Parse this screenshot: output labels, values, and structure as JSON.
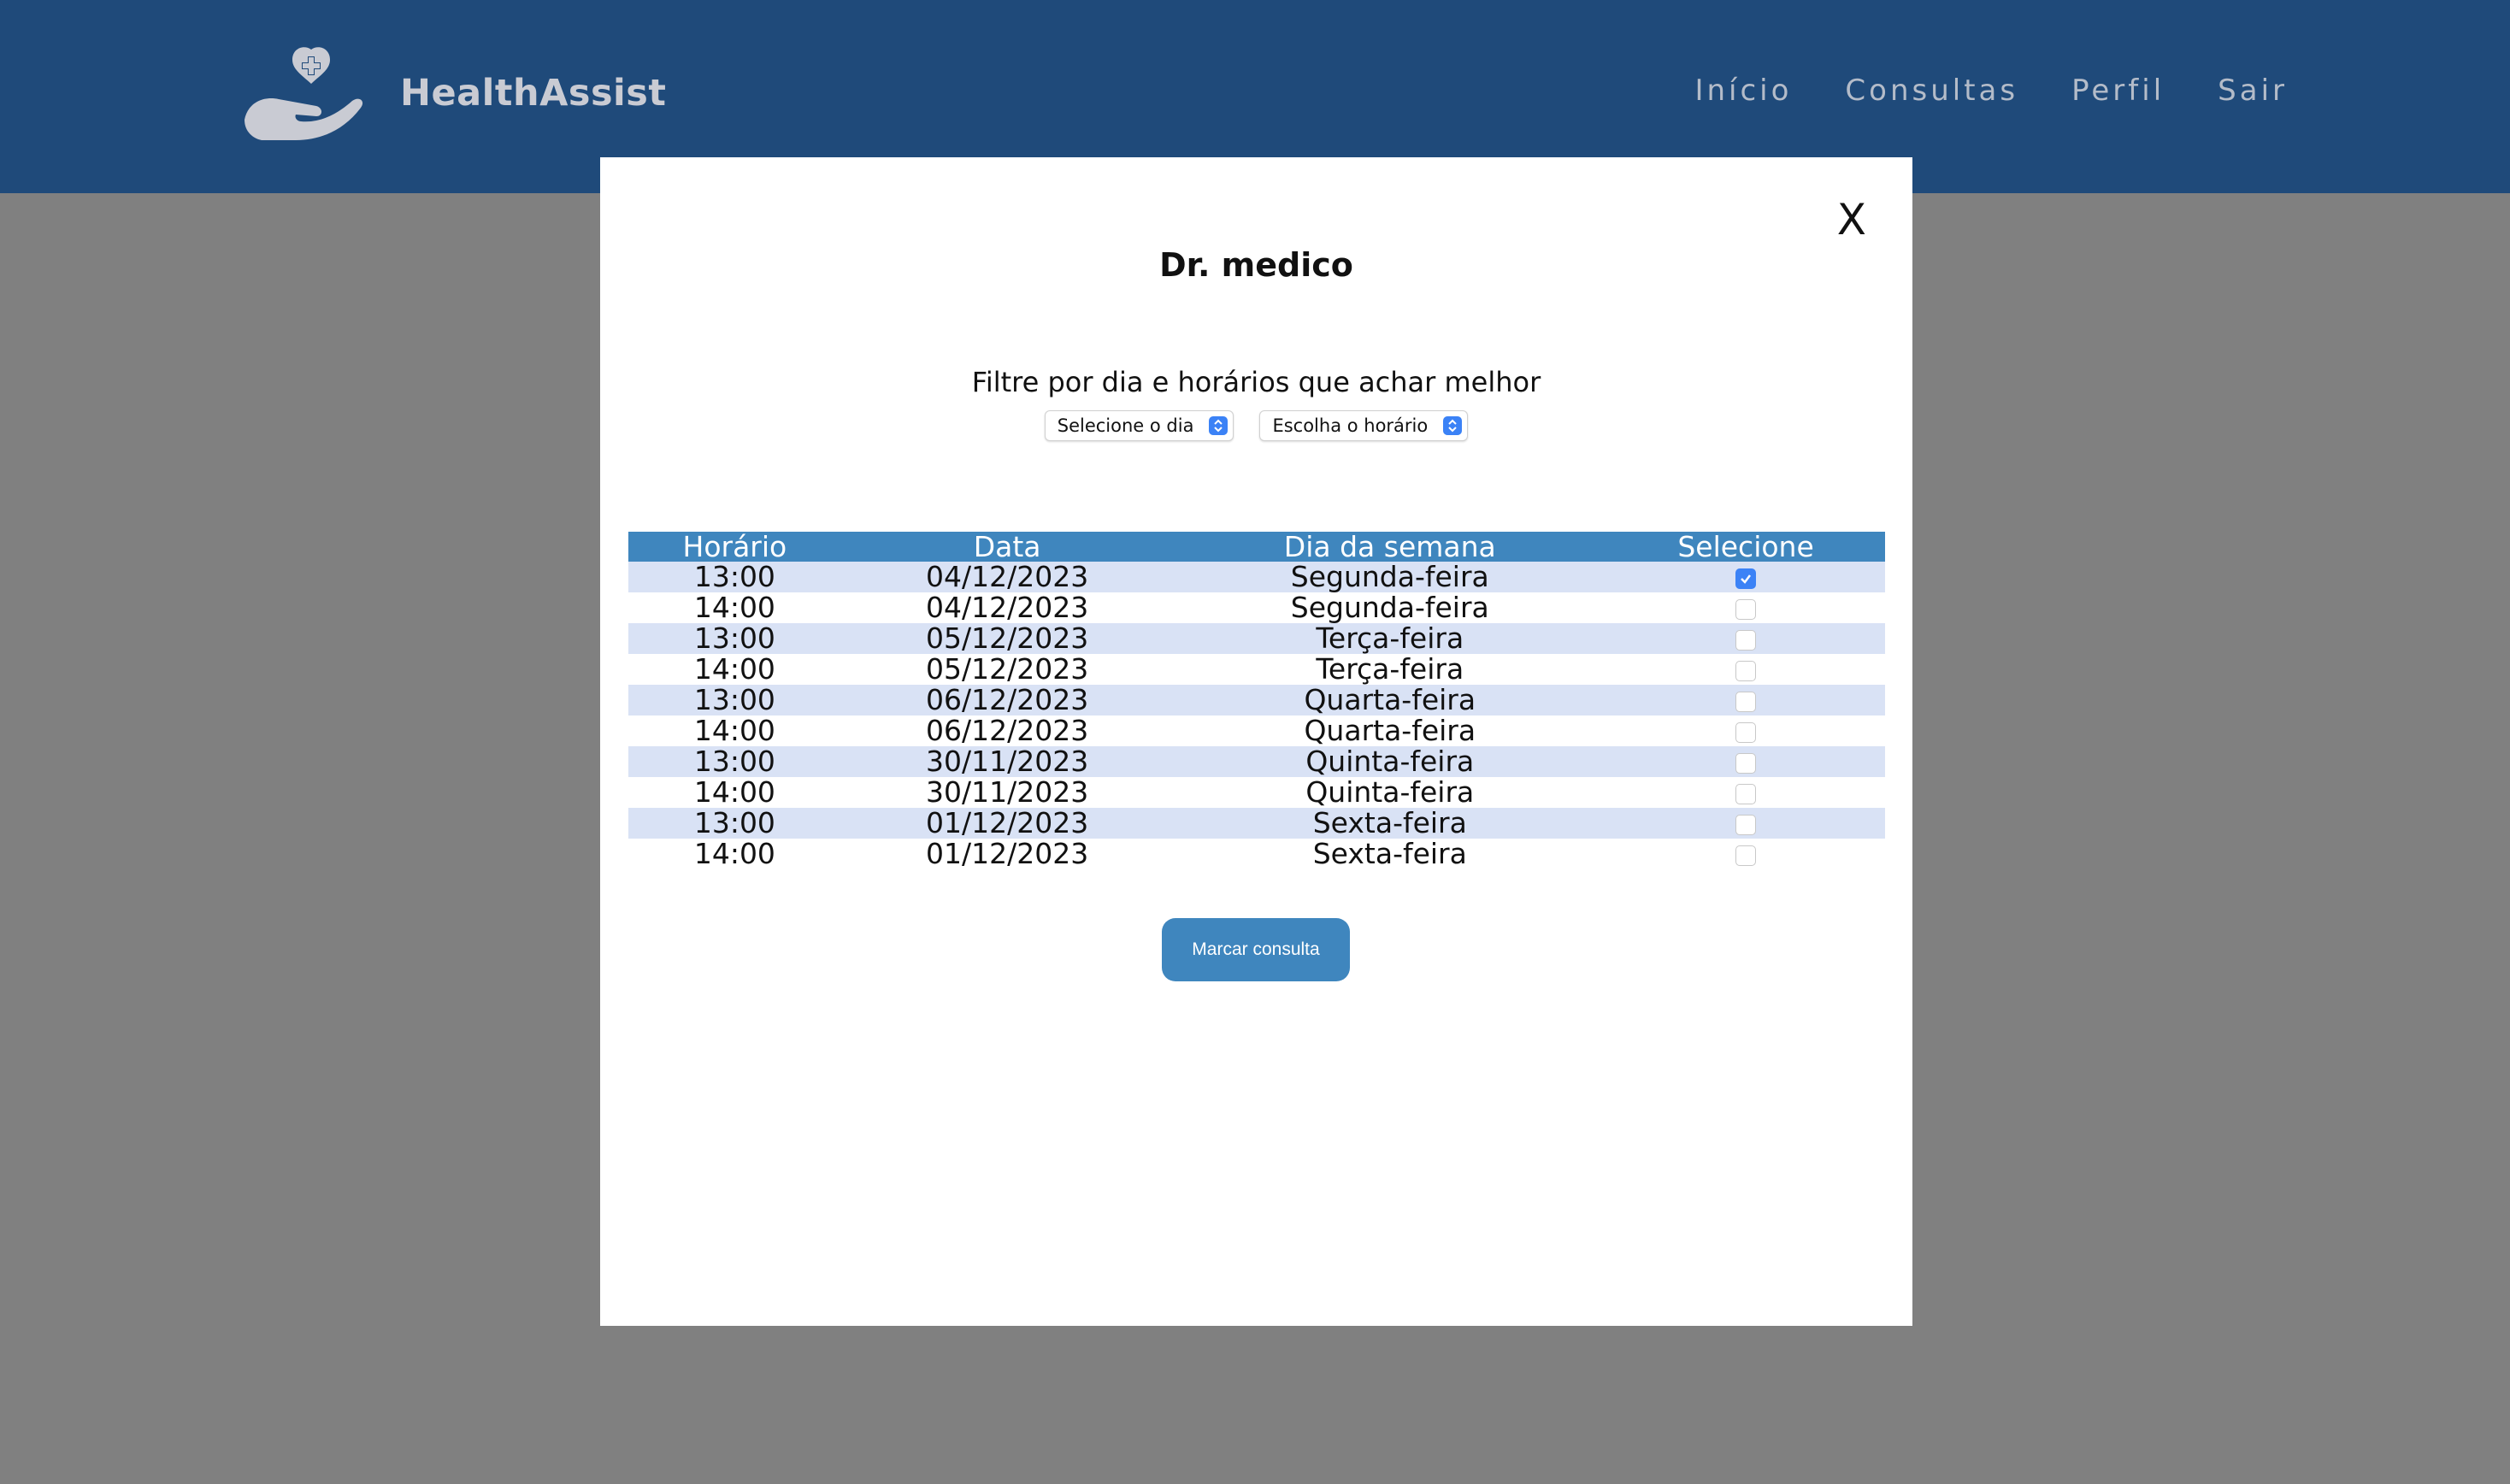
{
  "header": {
    "brand_name": "HealthAssist",
    "nav": [
      "Início",
      "Consultas",
      "Perfil",
      "Sair"
    ],
    "background_color": "#1f4a7a"
  },
  "modal": {
    "close_label": "X",
    "doctor_name": "Dr. medico",
    "filter_text": "Filtre por dia e horários que achar melhor",
    "day_select": "Selecione o dia",
    "time_select": "Escolha o horário",
    "table": {
      "headers": [
        "Horário",
        "Data",
        "Dia da semana",
        "Selecione"
      ],
      "rows": [
        {
          "time": "13:00",
          "date": "04/12/2023",
          "weekday": "Segunda-feira",
          "selected": true
        },
        {
          "time": "14:00",
          "date": "04/12/2023",
          "weekday": "Segunda-feira",
          "selected": false
        },
        {
          "time": "13:00",
          "date": "05/12/2023",
          "weekday": "Terça-feira",
          "selected": false
        },
        {
          "time": "14:00",
          "date": "05/12/2023",
          "weekday": "Terça-feira",
          "selected": false
        },
        {
          "time": "13:00",
          "date": "06/12/2023",
          "weekday": "Quarta-feira",
          "selected": false
        },
        {
          "time": "14:00",
          "date": "06/12/2023",
          "weekday": "Quarta-feira",
          "selected": false
        },
        {
          "time": "13:00",
          "date": "30/11/2023",
          "weekday": "Quinta-feira",
          "selected": false
        },
        {
          "time": "14:00",
          "date": "30/11/2023",
          "weekday": "Quinta-feira",
          "selected": false
        },
        {
          "time": "13:00",
          "date": "01/12/2023",
          "weekday": "Sexta-feira",
          "selected": false
        },
        {
          "time": "14:00",
          "date": "01/12/2023",
          "weekday": "Sexta-feira",
          "selected": false
        }
      ]
    },
    "book_button": "Marcar consulta",
    "accent_color": "#3f86be"
  }
}
